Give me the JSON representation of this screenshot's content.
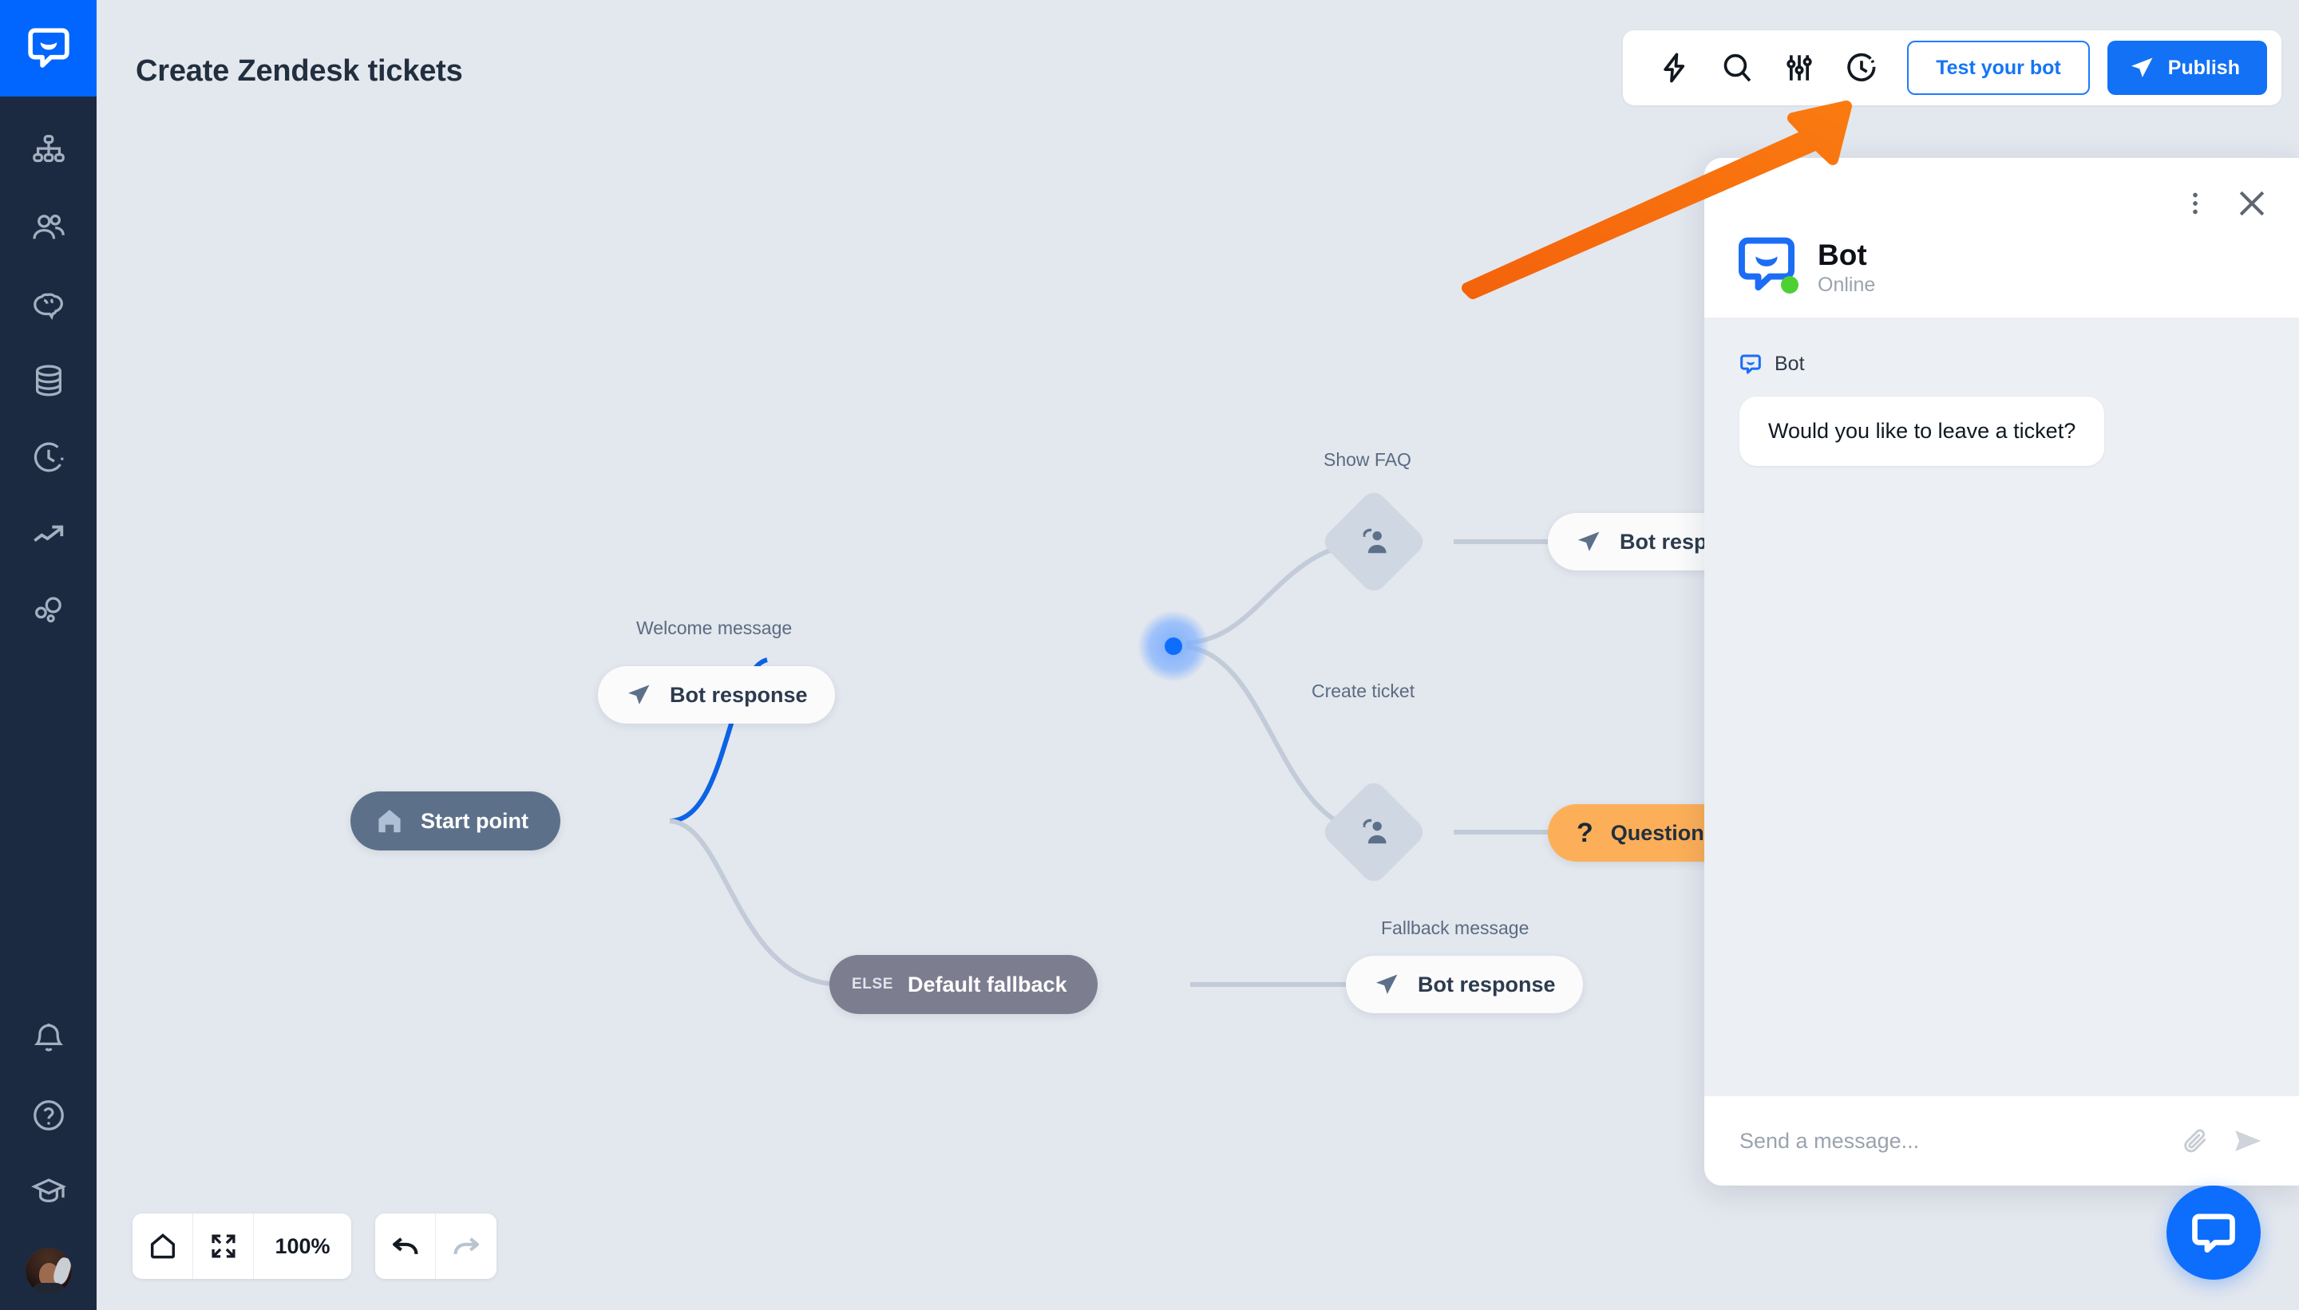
{
  "app": {
    "brand_icon": "chatbot-logo-icon",
    "accent_blue": "#0d6efd",
    "canvas_bg": "#e3e7ee",
    "sidebar_bg": "#1b2a41",
    "annotation_color": "#f4630c"
  },
  "sidebar": {
    "items": [
      {
        "icon": "org-chart-icon",
        "name": "sidebar-item-chatbots"
      },
      {
        "icon": "users-icon",
        "name": "sidebar-item-contacts"
      },
      {
        "icon": "brain-icon",
        "name": "sidebar-item-ai"
      },
      {
        "icon": "database-icon",
        "name": "sidebar-item-data"
      },
      {
        "icon": "history-clock-icon",
        "name": "sidebar-item-history"
      },
      {
        "icon": "trend-arrow-icon",
        "name": "sidebar-item-analytics"
      },
      {
        "icon": "bubbles-icon",
        "name": "sidebar-item-integrations"
      }
    ],
    "bottom_items": [
      {
        "icon": "bell-icon",
        "name": "sidebar-item-notifications"
      },
      {
        "icon": "question-circle-icon",
        "name": "sidebar-item-help"
      },
      {
        "icon": "graduation-cap-icon",
        "name": "sidebar-item-academy"
      }
    ],
    "avatar_name": "user-avatar"
  },
  "header": {
    "title": "Create Zendesk tickets"
  },
  "toolbar": {
    "icons": [
      {
        "icon": "lightning-bolt-icon",
        "name": "quick-actions-icon"
      },
      {
        "icon": "search-icon",
        "name": "search-icon"
      },
      {
        "icon": "sliders-icon",
        "name": "settings-sliders-icon"
      },
      {
        "icon": "history-clock-icon",
        "name": "version-history-icon"
      }
    ],
    "test_bot_label": "Test your bot",
    "publish_label": "Publish",
    "publish_icon": "send-plane-icon"
  },
  "flow": {
    "nodes": [
      {
        "id": "start",
        "type": "start",
        "label": "Start point",
        "icon": "home-icon",
        "caption": ""
      },
      {
        "id": "welcome",
        "type": "bot-response",
        "label": "Bot response",
        "icon": "send-plane-icon",
        "caption": "Welcome message"
      },
      {
        "id": "faq-branch",
        "type": "interaction-diamond",
        "label": "",
        "icon": "user-interaction-icon",
        "caption": "Show FAQ"
      },
      {
        "id": "faq-response",
        "type": "bot-response",
        "label": "Bot response",
        "icon": "send-plane-icon",
        "caption": ""
      },
      {
        "id": "ticket-branch",
        "type": "interaction-diamond",
        "label": "",
        "icon": "user-interaction-icon",
        "caption": "Create ticket"
      },
      {
        "id": "question",
        "type": "question",
        "label": "Question",
        "icon": "question-mark-icon",
        "caption": ""
      },
      {
        "id": "fallback",
        "type": "fallback",
        "label": "Default fallback",
        "badge": "ELSE",
        "caption": ""
      },
      {
        "id": "fallback-response",
        "type": "bot-response",
        "label": "Bot response",
        "icon": "send-plane-icon",
        "caption": "Fallback message"
      },
      {
        "id": "zendesk",
        "type": "integration",
        "label": "",
        "icon": "zendesk-logo-icon",
        "caption": ""
      }
    ]
  },
  "zoom_bar": {
    "home_icon": "home-icon",
    "fit_icon": "fit-screen-icon",
    "zoom_level": "100%",
    "undo_icon": "undo-arrow-icon",
    "redo_icon": "redo-arrow-icon"
  },
  "chat": {
    "bot_name": "Bot",
    "status": "Online",
    "menu_icon": "kebab-menu-icon",
    "close_icon": "close-icon",
    "avatar_icon": "chatbot-logo-icon",
    "message": {
      "sender": "Bot",
      "sender_icon": "chatbot-logo-icon",
      "text": "Would you like to leave a ticket?"
    },
    "input_placeholder": "Send a message...",
    "input_value": "",
    "attach_icon": "paperclip-icon",
    "send_icon": "send-plane-icon",
    "fab_icon": "chat-bubble-icon"
  }
}
